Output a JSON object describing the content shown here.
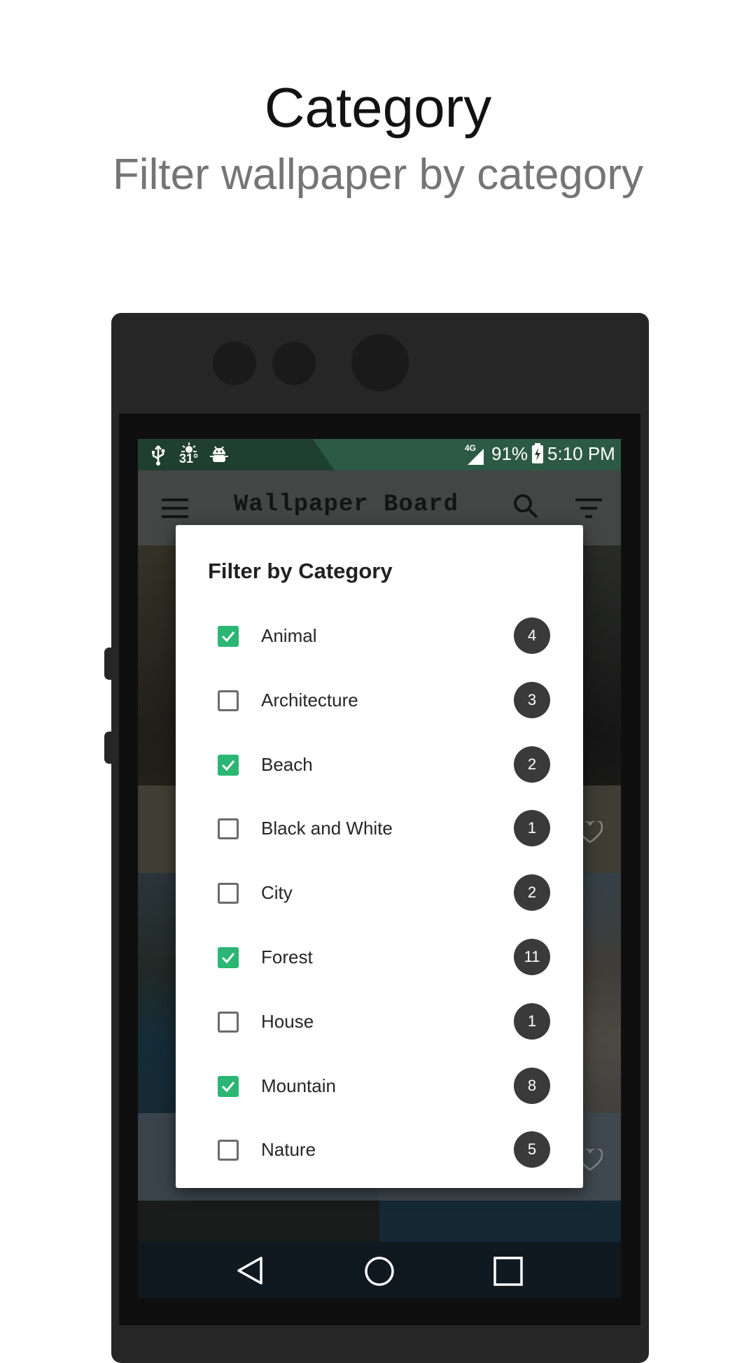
{
  "header": {
    "title": "Category",
    "subtitle": "Filter wallpaper by category"
  },
  "status_bar": {
    "temperature": "31°",
    "network": "4G",
    "battery": "91%",
    "time": "5:10 PM"
  },
  "toolbar": {
    "title": "Wallpaper Board"
  },
  "dialog": {
    "title": "Filter by Category",
    "items": [
      {
        "label": "Animal",
        "count": "4",
        "checked": true
      },
      {
        "label": "Architecture",
        "count": "3",
        "checked": false
      },
      {
        "label": "Beach",
        "count": "2",
        "checked": true
      },
      {
        "label": "Black and White",
        "count": "1",
        "checked": false
      },
      {
        "label": "City",
        "count": "2",
        "checked": false
      },
      {
        "label": "Forest",
        "count": "11",
        "checked": true
      },
      {
        "label": "House",
        "count": "1",
        "checked": false
      },
      {
        "label": "Mountain",
        "count": "8",
        "checked": true
      },
      {
        "label": "Nature",
        "count": "5",
        "checked": false
      }
    ]
  },
  "colors": {
    "checkbox_checked": "#2bb673",
    "badge": "#3a3a3a",
    "status_bar": "#1f3f30"
  }
}
